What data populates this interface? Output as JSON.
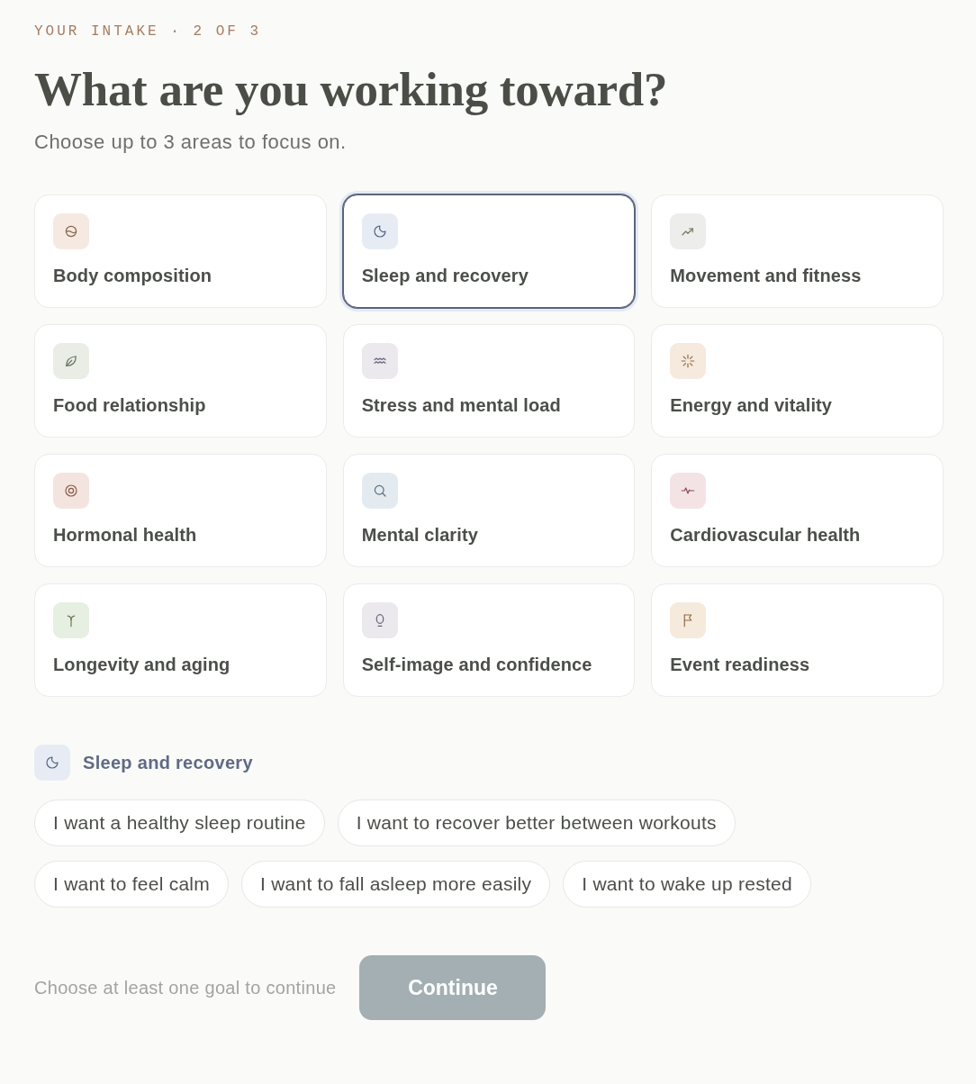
{
  "eyebrow": "YOUR INTAKE · 2 OF 3",
  "title": "What are you working toward?",
  "subtitle": "Choose up to 3 areas to focus on.",
  "areas": [
    {
      "label": "Body composition",
      "color": "#f5e9e2",
      "selected": false
    },
    {
      "label": "Sleep and recovery",
      "color": "#e7ecf4",
      "selected": true
    },
    {
      "label": "Movement and fitness",
      "color": "#ededeb",
      "selected": false
    },
    {
      "label": "Food relationship",
      "color": "#e9ede6",
      "selected": false
    },
    {
      "label": "Stress and mental load",
      "color": "#ebe9ee",
      "selected": false
    },
    {
      "label": "Energy and vitality",
      "color": "#f6e9dd",
      "selected": false
    },
    {
      "label": "Hormonal health",
      "color": "#f4e4df",
      "selected": false
    },
    {
      "label": "Mental clarity",
      "color": "#e4ebf0",
      "selected": false
    },
    {
      "label": "Cardiovascular health",
      "color": "#f4e3e5",
      "selected": false
    },
    {
      "label": "Longevity and aging",
      "color": "#e7efe2",
      "selected": false
    },
    {
      "label": "Self-image and confidence",
      "color": "#ebe8ee",
      "selected": false
    },
    {
      "label": "Event readiness",
      "color": "#f6eadd",
      "selected": false
    }
  ],
  "focus": {
    "title": "Sleep and recovery",
    "goals": [
      {
        "label": "I want a healthy sleep routine",
        "selected": false
      },
      {
        "label": "I want to recover better between workouts",
        "selected": false
      },
      {
        "label": "I want to feel calm",
        "selected": false
      },
      {
        "label": "I want to fall asleep more easily",
        "selected": false
      },
      {
        "label": "I want to wake up rested",
        "selected": false
      }
    ]
  },
  "footer": {
    "hint": "Choose at least one goal to continue",
    "continue_button": {
      "label": "Continue",
      "disabled": true
    }
  }
}
